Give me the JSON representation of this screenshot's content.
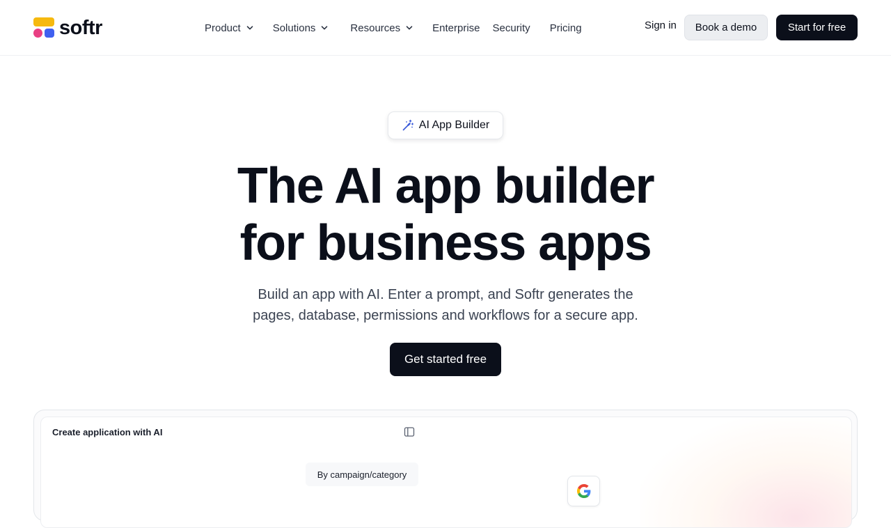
{
  "brand": {
    "name": "softr"
  },
  "nav": {
    "product": "Product",
    "solutions": "Solutions",
    "resources": "Resources",
    "enterprise": "Enterprise",
    "security": "Security",
    "pricing": "Pricing"
  },
  "header": {
    "sign_in": "Sign in",
    "book_demo": "Book a demo",
    "start_free": "Start for free"
  },
  "hero": {
    "badge": "AI App Builder",
    "headline_line1": "The AI app builder",
    "headline_line2": "for business apps",
    "subtitle_line1": "Build an app with AI. Enter a prompt, and Softr generates the",
    "subtitle_line2": "pages, database, permissions and workflows for a secure app.",
    "cta": "Get started free"
  },
  "preview": {
    "title": "Create application with AI",
    "chip": "By campaign/category"
  },
  "colors": {
    "primary": "#0b0f1a",
    "logo_yellow": "#f6b90f",
    "logo_pink": "#e93f83",
    "logo_blue": "#4060f0"
  },
  "icons": {
    "nav_dropdown": "chevron-down-icon",
    "badge": "magic-wand-icon",
    "sidebar": "sidebar-toggle-icon",
    "google": "google-icon"
  }
}
